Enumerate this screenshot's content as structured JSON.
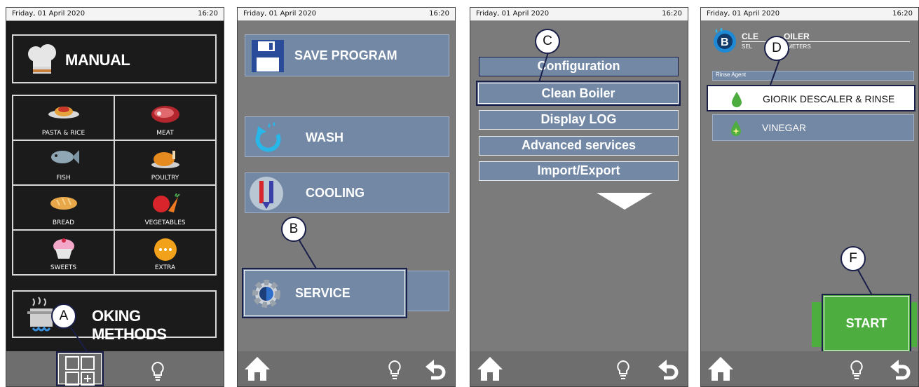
{
  "status": {
    "date": "Friday, 01 April 2020",
    "time": "16:20"
  },
  "panel1": {
    "manual_label": "MANUAL",
    "categories": [
      {
        "label": "PASTA & RICE",
        "icon": "pasta-icon"
      },
      {
        "label": "MEAT",
        "icon": "meat-icon"
      },
      {
        "label": "FISH",
        "icon": "fish-icon"
      },
      {
        "label": "POULTRY",
        "icon": "poultry-icon"
      },
      {
        "label": "BREAD",
        "icon": "bread-icon"
      },
      {
        "label": "VEGETABLES",
        "icon": "vegetables-icon"
      },
      {
        "label": "SWEETS",
        "icon": "sweets-icon"
      },
      {
        "label": "EXTRA",
        "icon": "extra-icon"
      }
    ],
    "cooking_methods_label": "OKING METHODS",
    "callout": "A"
  },
  "panel2": {
    "save_label": "SAVE PROGRAM",
    "wash_label": "WASH",
    "cooling_label": "COOLING",
    "service_label": "SERVICE",
    "callout": "B"
  },
  "panel3": {
    "items": [
      "Configuration",
      "Clean Boiler",
      "Display LOG",
      "Advanced services",
      "Import/Export"
    ],
    "callout": "C"
  },
  "panel4": {
    "title_left": "CLE",
    "title_right": "OILER",
    "subtitle_left": "SEL",
    "subtitle_right": "AMETERS",
    "rinse_agent_label": "Rinse Agent",
    "option1": "GIORIK DESCALER & RINSE",
    "option2": "VINEGAR",
    "start_label": "START",
    "callout_d": "D",
    "callout_f": "F"
  },
  "colors": {
    "accent_green": "#4dae3f",
    "button_blue": "#7288a5",
    "callout_navy": "#1a1f4a"
  }
}
